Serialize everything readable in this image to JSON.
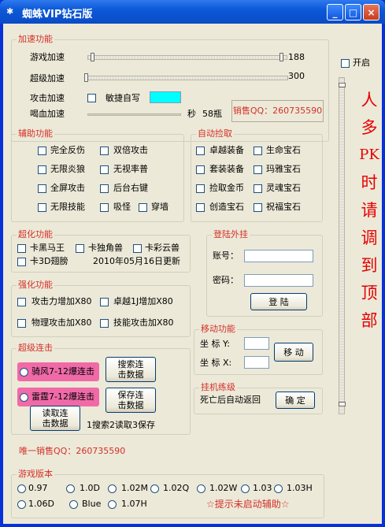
{
  "window": {
    "title": "蜘蛛VIP钻石版",
    "icon": "spider-icon",
    "minimize": "_",
    "maximize": "□",
    "close": "×"
  },
  "accel": {
    "title": "加速功能",
    "game_label": "游戏加速",
    "game_value": "188",
    "super_label": "超级加速",
    "super_value": "300",
    "attack_label": "攻击加速",
    "agile_label": "敏捷自写",
    "drink_label": "喝血加速",
    "drink_unit": "秒",
    "drink_value": "58瓶",
    "sales": "销售QQ：260735590"
  },
  "assist": {
    "title": "辅助功能",
    "items": [
      "完全反伤",
      "双倍攻击",
      "无限炎狼",
      "无视率普",
      "全屏攻击",
      "后台右键",
      "无限技能",
      "吸怪",
      "穿墙"
    ]
  },
  "pickup": {
    "title": "自动捡取",
    "items": [
      "卓越装备",
      "生命宝石",
      "套装装备",
      "玛雅宝石",
      "捡取金币",
      "灵魂宝石",
      "创造宝石",
      "祝福宝石"
    ]
  },
  "super": {
    "title": "超化功能",
    "items": [
      "卡黑马王",
      "卡独角兽",
      "卡彩云兽",
      "卡3D翅膀"
    ],
    "update": "2010年05月16日更新"
  },
  "login": {
    "title": "登陆外挂",
    "account_label": "账号：",
    "password_label": "密码：",
    "login_btn": "登 陆"
  },
  "enhance": {
    "title": "强化功能",
    "items": [
      "攻击力增加X80",
      "卓越1J增加X80",
      "物理攻击加X80",
      "技能攻击加X80"
    ]
  },
  "move": {
    "title": "移动功能",
    "y_label": "坐 标 Y:",
    "x_label": "坐 标 X:",
    "move_btn": "移 动"
  },
  "combo": {
    "title": "超级连击",
    "radio1": "骑风7-12爆连击",
    "radio2": "雷霆7-12爆连击",
    "search_btn": "搜索连击数据",
    "save_btn": "保存连击数据",
    "read_btn": "读取连击数据",
    "hint": "1搜索2读取3保存"
  },
  "afk": {
    "title": "挂机练级",
    "label": "死亡后自动返回",
    "ok_btn": "确 定"
  },
  "sales_only": "唯一销售QQ：260735590",
  "version": {
    "title": "游戏版本",
    "options": [
      "0.97",
      "1.0D",
      "1.02M",
      "1.02Q",
      "1.02W",
      "1.03",
      "1.03H",
      "1.06D",
      "Blue",
      "1.07H"
    ],
    "status": "☆提示未启动辅助☆"
  },
  "right": {
    "on_label": "开启",
    "notice": [
      "人",
      "多",
      "PK",
      "时",
      "请",
      "调",
      "到",
      "顶",
      "部"
    ]
  },
  "colors": {
    "accent": "#00ffff",
    "pink": "#f06aa8",
    "red": "#e60000"
  }
}
